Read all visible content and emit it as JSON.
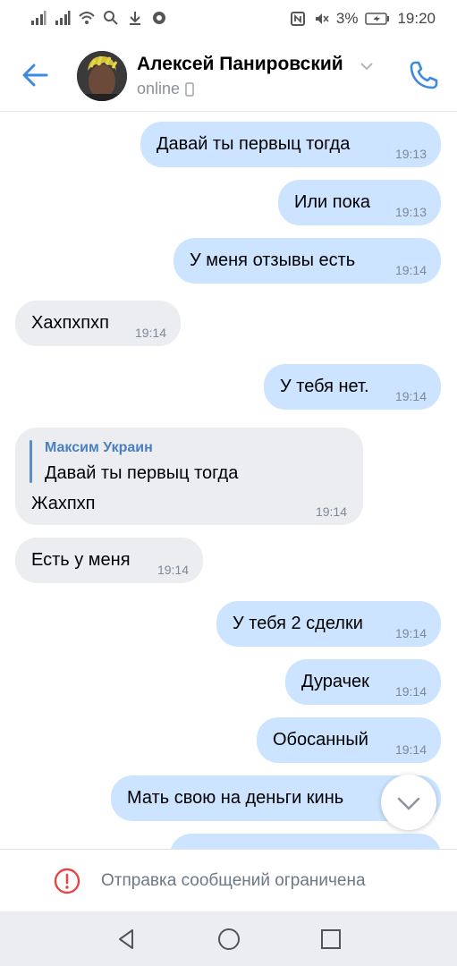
{
  "status_bar": {
    "battery": "3%",
    "time": "19:20"
  },
  "header": {
    "contact_name": "Алексей Панировский",
    "status": "online"
  },
  "messages": [
    {
      "dir": "out",
      "text": "Давай ты первыц тогда",
      "time": "19:13"
    },
    {
      "dir": "out",
      "text": "Или пока",
      "time": "19:13"
    },
    {
      "dir": "out",
      "text": "У меня отзывы есть",
      "time": "19:14"
    },
    {
      "dir": "in",
      "text": "Хахпхпхп",
      "time": "19:14"
    },
    {
      "dir": "out",
      "text": "У тебя нет.",
      "time": "19:14"
    },
    {
      "dir": "in",
      "reply_author": "Максим Украин",
      "reply_text": "Давай ты первыц тогда",
      "text": "Жахпхп",
      "time": "19:14"
    },
    {
      "dir": "in",
      "text": "Есть у меня",
      "time": "19:14"
    },
    {
      "dir": "out",
      "text": "У тебя 2 сделки",
      "time": "19:14"
    },
    {
      "dir": "out",
      "text": "Дурачек",
      "time": "19:14"
    },
    {
      "dir": "out",
      "text": "Обосанный",
      "time": "19:14"
    },
    {
      "dir": "out",
      "text": "Мать свою на деньги кинь",
      "time": ""
    }
  ],
  "restriction": {
    "text": "Отправка сообщений ограничена"
  },
  "icons": {
    "back": "arrow-left-icon",
    "call": "phone-icon",
    "scroll_down": "chevron-down-icon",
    "restriction": "error-circle-icon",
    "nav": [
      "nav-back-icon",
      "nav-home-icon",
      "nav-recents-icon"
    ]
  },
  "colors": {
    "accent": "#3f8ae0",
    "bubble_out": "#cce4ff",
    "bubble_in": "#ebedf0",
    "error": "#e64646"
  }
}
